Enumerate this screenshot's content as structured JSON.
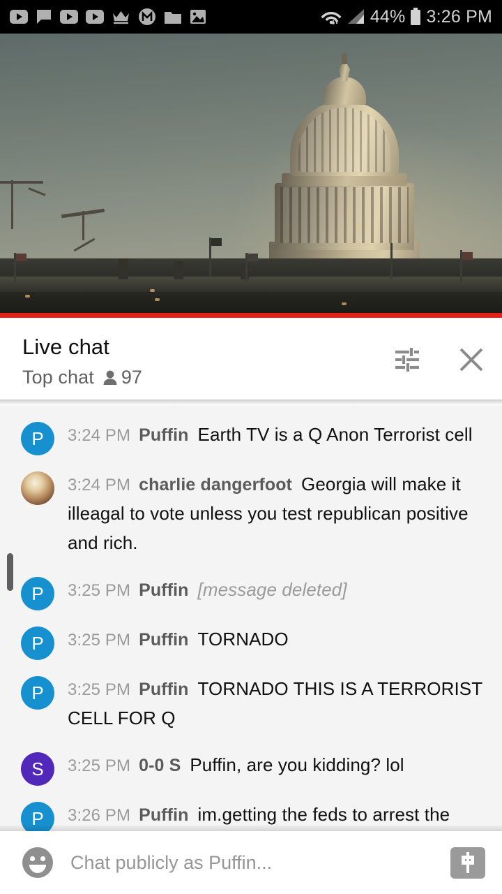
{
  "status_bar": {
    "left_icons": [
      "youtube-play-icon",
      "chat-bubble-icon",
      "youtube-play-icon-2",
      "youtube-play-icon-3",
      "crown-icon",
      "m-circle-icon",
      "folder-icon",
      "image-icon"
    ],
    "wifi_icon": "wifi-icon",
    "signal_icon": "cellular-signal-icon",
    "battery_percent": "44%",
    "battery_icon": "battery-icon",
    "clock": "3:26 PM"
  },
  "video": {
    "description": "US Capitol dome live stream at sunset",
    "progress_color": "#e52117"
  },
  "chat_header": {
    "title": "Live chat",
    "mode": "Top chat",
    "viewer_icon": "person-icon",
    "viewer_count": "97",
    "settings_icon": "tune-settings-icon",
    "close_icon": "close-icon"
  },
  "messages": [
    {
      "time": "3:24 PM",
      "author": "Puffin",
      "text": "Earth TV is a Q Anon Terrorist cell",
      "avatar_type": "letter",
      "avatar_letter": "P",
      "avatar_color": "#1790d0",
      "deleted": false
    },
    {
      "time": "3:24 PM",
      "author": "charlie dangerfoot",
      "text": "Georgia will make it illeagal to vote unless you test republican positive and rich.",
      "avatar_type": "photo",
      "avatar_letter": "",
      "avatar_color": "#b98f63",
      "deleted": false
    },
    {
      "time": "3:25 PM",
      "author": "Puffin",
      "text": "[message deleted]",
      "avatar_type": "letter",
      "avatar_letter": "P",
      "avatar_color": "#1790d0",
      "deleted": true
    },
    {
      "time": "3:25 PM",
      "author": "Puffin",
      "text": "TORNADO",
      "avatar_type": "letter",
      "avatar_letter": "P",
      "avatar_color": "#1790d0",
      "deleted": false
    },
    {
      "time": "3:25 PM",
      "author": "Puffin",
      "text": "TORNADO THIS IS A TERRORIST CELL FOR Q",
      "avatar_type": "letter",
      "avatar_letter": "P",
      "avatar_color": "#1790d0",
      "deleted": false
    },
    {
      "time": "3:25 PM",
      "author": "0-0 S",
      "text": "Puffin, are you kidding? lol",
      "avatar_type": "letter",
      "avatar_letter": "S",
      "avatar_color": "#5228ba",
      "deleted": false
    },
    {
      "time": "3:26 PM",
      "author": "Puffin",
      "text": "im.getting the feds to arrest the mods",
      "avatar_type": "letter",
      "avatar_letter": "P",
      "avatar_color": "#1790d0",
      "deleted": false
    }
  ],
  "input_bar": {
    "emoji_icon": "emoji-smiley-icon",
    "placeholder": "Chat publicly as Puffin...",
    "value": "",
    "superchat_icon": "dollar-superchat-icon"
  }
}
